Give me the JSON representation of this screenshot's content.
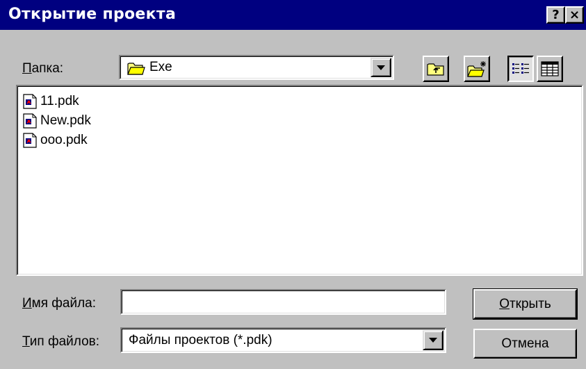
{
  "window": {
    "title": "Открытие проекта",
    "help_glyph": "?",
    "close_glyph": "×"
  },
  "folder": {
    "label_accel": "П",
    "label_rest": "апка:",
    "value": "Exe"
  },
  "toolbar": {
    "up_icon": "up-folder-icon",
    "new_folder_icon": "new-folder-icon",
    "list_view_icon": "list-view-icon",
    "details_view_icon": "details-view-icon"
  },
  "files": [
    {
      "name": "11.pdk"
    },
    {
      "name": "New.pdk"
    },
    {
      "name": "ooo.pdk"
    }
  ],
  "filename": {
    "label_accel": "И",
    "label_rest": "мя файла:",
    "value": ""
  },
  "filetype": {
    "label_accel": "Т",
    "label_rest": "ип файлов:",
    "value": "Файлы проектов (*.pdk)"
  },
  "buttons": {
    "open_accel": "О",
    "open_rest": "ткрыть",
    "cancel": "Отмена"
  }
}
